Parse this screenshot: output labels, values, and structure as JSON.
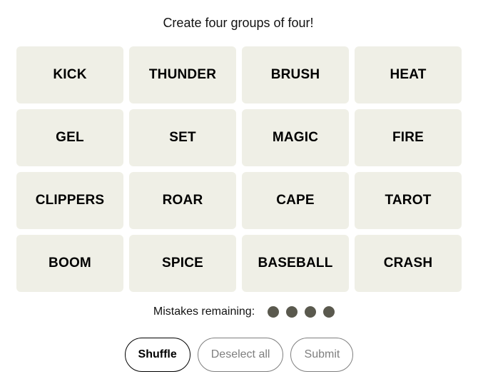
{
  "instructions": "Create four groups of four!",
  "tiles": [
    "KICK",
    "THUNDER",
    "BRUSH",
    "HEAT",
    "GEL",
    "SET",
    "MAGIC",
    "FIRE",
    "CLIPPERS",
    "ROAR",
    "CAPE",
    "TAROT",
    "BOOM",
    "SPICE",
    "BASEBALL",
    "CRASH"
  ],
  "mistakes": {
    "label": "Mistakes remaining:",
    "remaining": 4,
    "dot_color": "#5a594e"
  },
  "controls": {
    "shuffle_label": "Shuffle",
    "deselect_label": "Deselect all",
    "submit_label": "Submit"
  },
  "colors": {
    "tile_bg": "#efefe6",
    "disabled_text": "#7f7f7f"
  }
}
